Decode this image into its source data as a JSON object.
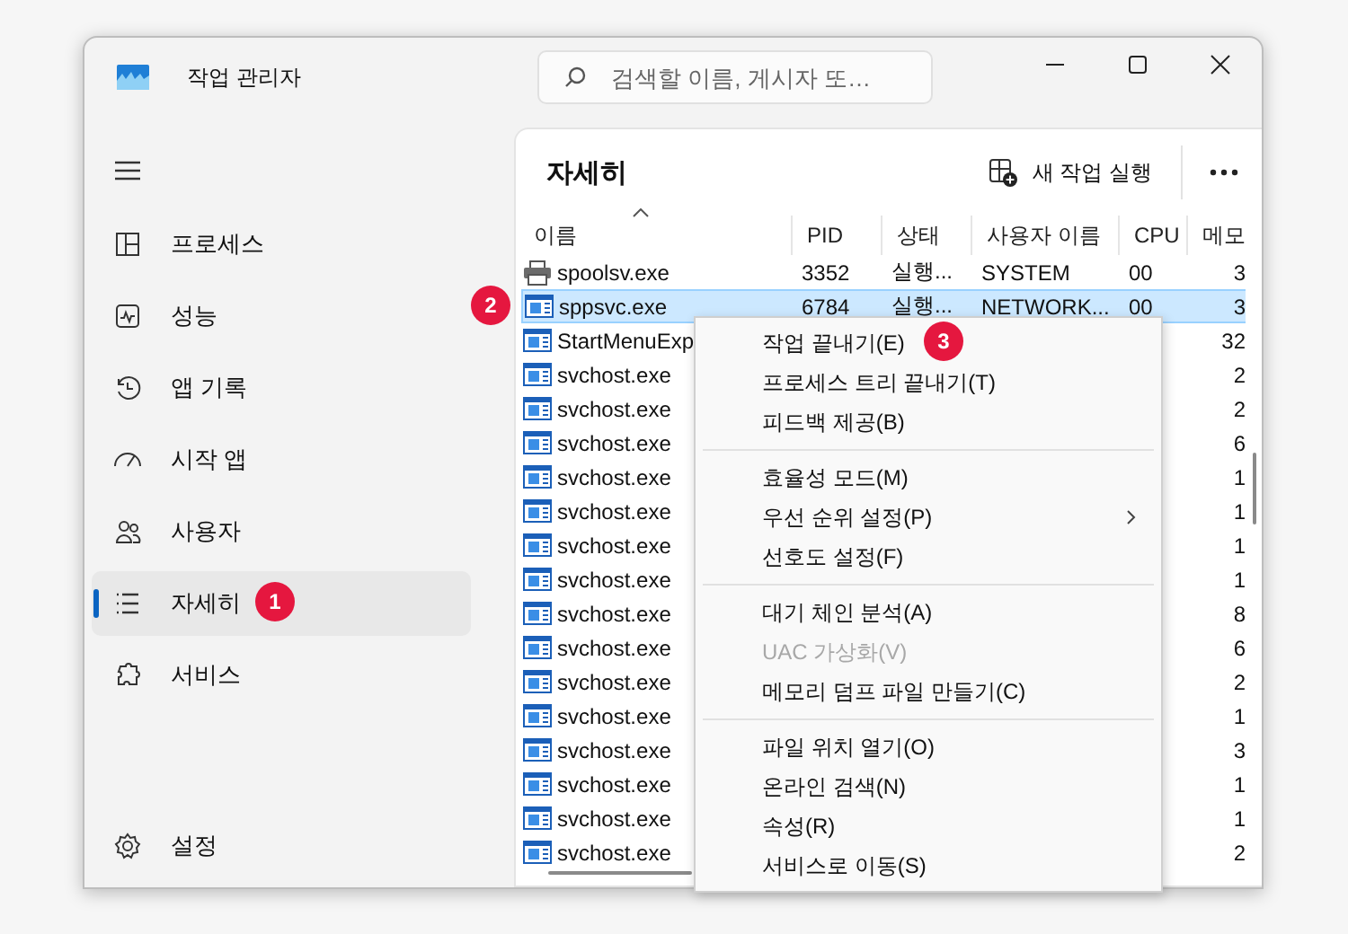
{
  "window": {
    "title": "작업 관리자"
  },
  "search": {
    "placeholder": "검색할 이름, 게시자 또…"
  },
  "sidebar": {
    "items": [
      {
        "label": "프로세스",
        "selected": false
      },
      {
        "label": "성능",
        "selected": false
      },
      {
        "label": "앱 기록",
        "selected": false
      },
      {
        "label": "시작 앱",
        "selected": false
      },
      {
        "label": "사용자",
        "selected": false
      },
      {
        "label": "자세히",
        "selected": true
      },
      {
        "label": "서비스",
        "selected": false
      }
    ],
    "settings": {
      "label": "설정"
    }
  },
  "details": {
    "title": "자세히",
    "run_task": "새 작업 실행",
    "columns": [
      {
        "label": "이름",
        "sorted": true
      },
      {
        "label": "PID",
        "sorted": false
      },
      {
        "label": "상태",
        "sorted": false
      },
      {
        "label": "사용자 이름",
        "sorted": false
      },
      {
        "label": "CPU",
        "sorted": false
      },
      {
        "label": "메모",
        "sorted": false
      }
    ],
    "rows": [
      {
        "kind": "printer",
        "name": "spoolsv.exe",
        "pid": "3352",
        "status": "실행...",
        "user": "SYSTEM",
        "cpu": "00",
        "memory": "3",
        "selected": false
      },
      {
        "kind": "program",
        "name": "sppsvc.exe",
        "pid": "6784",
        "status": "실행...",
        "user": "NETWORK...",
        "cpu": "00",
        "memory": "3",
        "selected": true
      },
      {
        "kind": "program",
        "name": "StartMenuExp",
        "memory": "32",
        "selected": false
      },
      {
        "kind": "program",
        "name": "svchost.exe",
        "memory": "2",
        "selected": false
      },
      {
        "kind": "program",
        "name": "svchost.exe",
        "memory": "2",
        "selected": false
      },
      {
        "kind": "program",
        "name": "svchost.exe",
        "memory": "6",
        "selected": false
      },
      {
        "kind": "program",
        "name": "svchost.exe",
        "memory": "1",
        "selected": false
      },
      {
        "kind": "program",
        "name": "svchost.exe",
        "memory": "1",
        "selected": false
      },
      {
        "kind": "program",
        "name": "svchost.exe",
        "memory": "1",
        "selected": false
      },
      {
        "kind": "program",
        "name": "svchost.exe",
        "memory": "1",
        "selected": false
      },
      {
        "kind": "program",
        "name": "svchost.exe",
        "memory": "8",
        "selected": false
      },
      {
        "kind": "program",
        "name": "svchost.exe",
        "memory": "6",
        "selected": false
      },
      {
        "kind": "program",
        "name": "svchost.exe",
        "memory": "2",
        "selected": false
      },
      {
        "kind": "program",
        "name": "svchost.exe",
        "memory": "1",
        "selected": false
      },
      {
        "kind": "program",
        "name": "svchost.exe",
        "memory": "3",
        "selected": false
      },
      {
        "kind": "program",
        "name": "svchost.exe",
        "memory": "1",
        "selected": false
      },
      {
        "kind": "program",
        "name": "svchost.exe",
        "memory": "1",
        "selected": false
      },
      {
        "kind": "program",
        "name": "svchost.exe",
        "memory": "2",
        "selected": false
      }
    ]
  },
  "context_menu": {
    "groups": [
      [
        {
          "label": "작업 끝내기(E)",
          "disabled": false,
          "submenu": false
        },
        {
          "label": "프로세스 트리 끝내기(T)",
          "disabled": false,
          "submenu": false
        },
        {
          "label": "피드백 제공(B)",
          "disabled": false,
          "submenu": false
        }
      ],
      [
        {
          "label": "효율성 모드(M)",
          "disabled": false,
          "submenu": false
        },
        {
          "label": "우선 순위 설정(P)",
          "disabled": false,
          "submenu": true
        },
        {
          "label": "선호도 설정(F)",
          "disabled": false,
          "submenu": false
        }
      ],
      [
        {
          "label": "대기 체인 분석(A)",
          "disabled": false,
          "submenu": false
        },
        {
          "label": "UAC 가상화(V)",
          "disabled": true,
          "submenu": false
        },
        {
          "label": "메모리 덤프 파일 만들기(C)",
          "disabled": false,
          "submenu": false
        }
      ],
      [
        {
          "label": "파일 위치 열기(O)",
          "disabled": false,
          "submenu": false
        },
        {
          "label": "온라인 검색(N)",
          "disabled": false,
          "submenu": false
        },
        {
          "label": "속성(R)",
          "disabled": false,
          "submenu": false
        },
        {
          "label": "서비스로 이동(S)",
          "disabled": false,
          "submenu": false
        }
      ]
    ]
  },
  "annotations": [
    {
      "label": "1"
    },
    {
      "label": "2"
    },
    {
      "label": "3"
    }
  ]
}
